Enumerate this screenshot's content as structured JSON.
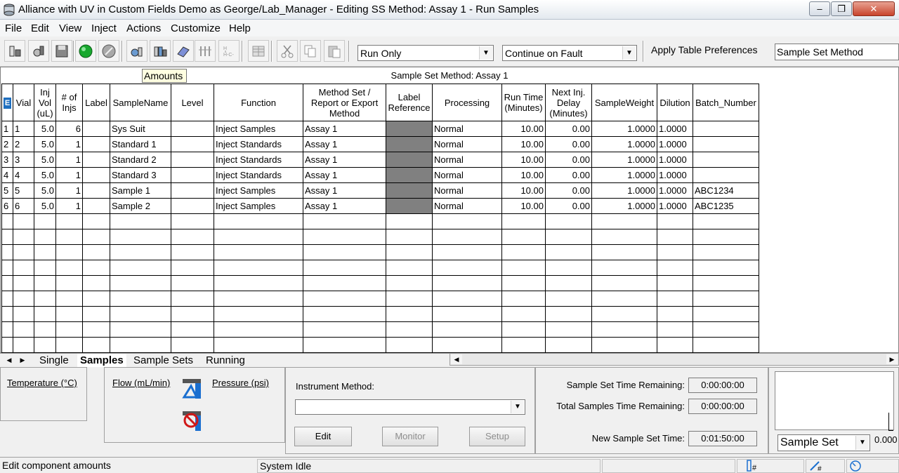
{
  "window": {
    "title": "Alliance with UV in Custom Fields Demo as George/Lab_Manager - Editing SS Method: Assay 1 - Run Samples",
    "min_glyph": "–",
    "max_glyph": "❐",
    "close_glyph": "✕"
  },
  "menu": [
    "File",
    "Edit",
    "View",
    "Inject",
    "Actions",
    "Customize",
    "Help"
  ],
  "toolbar": {
    "run_mode": "Run Only",
    "fault_mode": "Continue on Fault",
    "apply_table_prefs": "Apply Table Preferences",
    "table_pref_value": "Sample Set Method",
    "dropdown_arrow": "▼"
  },
  "grid": {
    "tooltip": "Amounts",
    "caption": "Sample Set Method: Assay 1",
    "corner_icon": "E",
    "headers": [
      "Vial",
      "Inj Vol (uL)",
      "# of Injs",
      "Label",
      "SampleName",
      "Level",
      "Function",
      "Method Set / Report or Export Method",
      "Label Reference",
      "Processing",
      "Run Time (Minutes)",
      "Next Inj. Delay (Minutes)",
      "SampleWeight",
      "Dilution",
      "Batch_Number"
    ],
    "rows": [
      {
        "num": "1",
        "vial": "1",
        "injvol": "5.0",
        "injs": "6",
        "label": "",
        "name": "Sys Suit",
        "level": "",
        "func": "Inject Samples",
        "method": "Assay 1",
        "labelref": "",
        "proc": "Normal",
        "runtime": "10.00",
        "delay": "0.00",
        "weight": "1.0000",
        "dilution": "1.0000",
        "batch": ""
      },
      {
        "num": "2",
        "vial": "2",
        "injvol": "5.0",
        "injs": "1",
        "label": "",
        "name": "Standard 1",
        "level": "",
        "func": "Inject Standards",
        "method": "Assay 1",
        "labelref": "",
        "proc": "Normal",
        "runtime": "10.00",
        "delay": "0.00",
        "weight": "1.0000",
        "dilution": "1.0000",
        "batch": ""
      },
      {
        "num": "3",
        "vial": "3",
        "injvol": "5.0",
        "injs": "1",
        "label": "",
        "name": "Standard 2",
        "level": "",
        "func": "Inject Standards",
        "method": "Assay 1",
        "labelref": "",
        "proc": "Normal",
        "runtime": "10.00",
        "delay": "0.00",
        "weight": "1.0000",
        "dilution": "1.0000",
        "batch": ""
      },
      {
        "num": "4",
        "vial": "4",
        "injvol": "5.0",
        "injs": "1",
        "label": "",
        "name": "Standard 3",
        "level": "",
        "func": "Inject Standards",
        "method": "Assay 1",
        "labelref": "",
        "proc": "Normal",
        "runtime": "10.00",
        "delay": "0.00",
        "weight": "1.0000",
        "dilution": "1.0000",
        "batch": ""
      },
      {
        "num": "5",
        "vial": "5",
        "injvol": "5.0",
        "injs": "1",
        "label": "",
        "name": "Sample 1",
        "level": "",
        "func": "Inject Samples",
        "method": "Assay 1",
        "labelref": "",
        "proc": "Normal",
        "runtime": "10.00",
        "delay": "0.00",
        "weight": "1.0000",
        "dilution": "1.0000",
        "batch": "ABC1234"
      },
      {
        "num": "6",
        "vial": "6",
        "injvol": "5.0",
        "injs": "1",
        "label": "",
        "name": "Sample 2",
        "level": "",
        "func": "Inject Samples",
        "method": "Assay 1",
        "labelref": "",
        "proc": "Normal",
        "runtime": "10.00",
        "delay": "0.00",
        "weight": "1.0000",
        "dilution": "1.0000",
        "batch": "ABC1235"
      }
    ],
    "empty_rows": 9
  },
  "tabs": {
    "nav_left": "◀",
    "nav_right": "▶",
    "items": [
      "Single",
      "Samples",
      "Sample Sets",
      "Running"
    ],
    "active": "Samples"
  },
  "hscroll": {
    "left": "◀",
    "right": "▶"
  },
  "bottom": {
    "temperature_label": "Temperature (°C)",
    "flow_label": "Flow (mL/min)",
    "pressure_label": "Pressure (psi)",
    "instrument_method_label": "Instrument Method:",
    "instrument_method_value": "",
    "edit_button": "Edit",
    "monitor_button": "Monitor",
    "setup_button": "Setup",
    "ss_time_remaining_label": "Sample Set Time Remaining:",
    "ss_time_remaining": "0:00:00:00",
    "total_time_remaining_label": "Total Samples Time Remaining:",
    "total_time_remaining": "0:00:00:00",
    "new_ss_time_label": "New Sample Set Time:",
    "new_ss_time": "0:01:50:00",
    "view_select": "Sample Set",
    "view_value": "0.000"
  },
  "status": {
    "hint": "Edit component amounts",
    "state": "System Idle"
  },
  "colors": {
    "label_ref_cell": "#808080",
    "tooltip_bg": "#ffffe1"
  }
}
